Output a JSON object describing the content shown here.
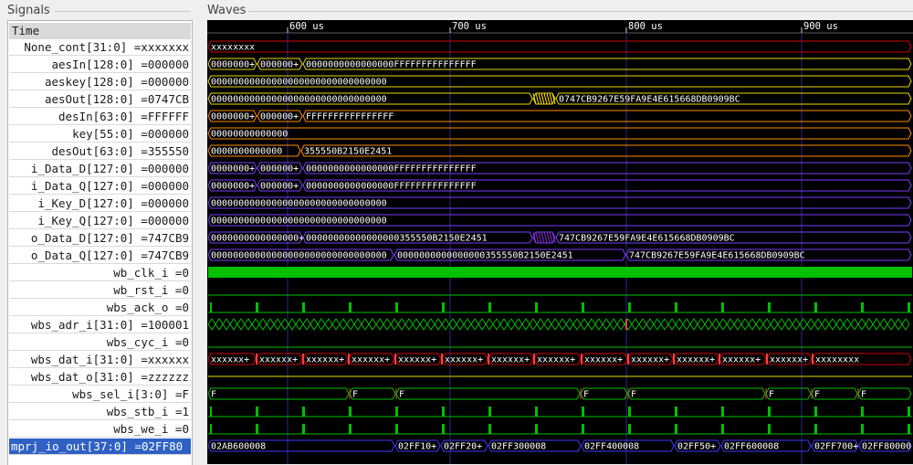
{
  "panels": {
    "signals_title": "Signals",
    "waves_title": "Waves"
  },
  "time_header": {
    "label": "Time",
    "markers": [
      "600 us",
      "700 us",
      "800 us",
      "900 us"
    ]
  },
  "colors": {
    "background": "#000000",
    "bus": "#3b3bff",
    "bit_high": "#00c000",
    "text": "#ffffff",
    "highlight_red": "#e00000",
    "highlight_yellow": "#ffe000",
    "highlight_purple": "#8a2be2",
    "selected_row": "#2f61c5"
  },
  "signals": [
    {
      "label": "None_cont[31:0] =xxxxxxx",
      "kind": "bus",
      "color": "#d00000",
      "segments": [
        [
          "xxxxxxxx"
        ]
      ]
    },
    {
      "label": "aesIn[128:0] =000000",
      "kind": "bus",
      "color": "#e8d800",
      "segments": [
        [
          "0000000+"
        ],
        [
          "000000+"
        ],
        [
          "0000000000000000FFFFFFFFFFFFFFF"
        ]
      ]
    },
    {
      "label": "aeskey[128:0] =000000",
      "kind": "bus",
      "color": "#e8d800",
      "segments": [
        [
          "00000000000000000000000000000000"
        ]
      ]
    },
    {
      "label": "aesOut[128:0] =0747CB",
      "kind": "bus",
      "color": "#e8d800",
      "segments": [
        [
          "00000000000000000000000000000000"
        ],
        [
          ""
        ],
        [
          "0747CB9267E59FA9E4E615668DB0909BC"
        ]
      ]
    },
    {
      "label": "desIn[63:0] =FFFFFF",
      "kind": "bus",
      "color": "#ff8c00",
      "segments": [
        [
          "0000000+"
        ],
        [
          "000000+"
        ],
        [
          "FFFFFFFFFFFFFFFF"
        ]
      ]
    },
    {
      "label": "key[55:0] =000000",
      "kind": "bus",
      "color": "#ff8c00",
      "segments": [
        [
          "00000000000000"
        ]
      ]
    },
    {
      "label": "desOut[63:0] =355550",
      "kind": "bus",
      "color": "#ff8c00",
      "segments": [
        [
          "0000000000000"
        ],
        [
          "355550B2150E2451"
        ]
      ]
    },
    {
      "label": "i_Data_D[127:0] =000000",
      "kind": "bus",
      "color": "#7a3cff",
      "segments": [
        [
          "0000000+"
        ],
        [
          "000000+"
        ],
        [
          "0000000000000000FFFFFFFFFFFFFFF"
        ]
      ]
    },
    {
      "label": "i_Data_Q[127:0] =000000",
      "kind": "bus",
      "color": "#7a3cff",
      "segments": [
        [
          "0000000+"
        ],
        [
          "000000+"
        ],
        [
          "0000000000000000FFFFFFFFFFFFFFF"
        ]
      ]
    },
    {
      "label": "i_Key_D[127:0] =000000",
      "kind": "bus",
      "color": "#7a3cff",
      "segments": [
        [
          "00000000000000000000000000000000"
        ]
      ]
    },
    {
      "label": "i_Key_Q[127:0] =000000",
      "kind": "bus",
      "color": "#7a3cff",
      "segments": [
        [
          "00000000000000000000000000000000"
        ]
      ]
    },
    {
      "label": "o_Data_D[127:0] =747CB9",
      "kind": "bus",
      "color": "#7a3cff",
      "segments": [
        [
          "0000000000000000+"
        ],
        [
          "00000000000000000355550B2150E2451"
        ],
        [
          ""
        ],
        [
          "747CB9267E59FA9E4E615668DB0909BC"
        ]
      ]
    },
    {
      "label": "o_Data_Q[127:0] =747CB9",
      "kind": "bus",
      "color": "#7a3cff",
      "segments": [
        [
          "00000000000000000000000000000000"
        ],
        [
          "0000000000000000355550B2150E2451"
        ],
        [
          "747CB9267E59FA9E4E615668DB0909BC"
        ]
      ]
    },
    {
      "label": "wb_clk_i =0",
      "kind": "clock",
      "color": "#00c000",
      "segments": []
    },
    {
      "label": "wb_rst_i =0",
      "kind": "bit-low",
      "color": "#00c000",
      "segments": []
    },
    {
      "label": "wbs_ack_o =0",
      "kind": "pulses",
      "color": "#00c000",
      "segments": []
    },
    {
      "label": "wbs_adr_i[31:0] =100001",
      "kind": "dense",
      "color": "#00c000",
      "segments": []
    },
    {
      "label": "wbs_cyc_i =0",
      "kind": "bit-low",
      "color": "#00c000",
      "segments": []
    },
    {
      "label": "wbs_dat_i[31:0] =xxxxxx",
      "kind": "repeat",
      "color": "#d00000",
      "segments": [
        [
          "xxxxxx+"
        ],
        [
          "xxxxxx+"
        ],
        [
          "xxxxxx+"
        ],
        [
          "xxxxxx+"
        ],
        [
          "xxxxxx+"
        ],
        [
          "xxxxxx+"
        ],
        [
          "xxxxxx+"
        ],
        [
          "xxxxxx+"
        ],
        [
          "xxxxxx+"
        ],
        [
          "xxxxxx+"
        ],
        [
          "xxxxxx+"
        ],
        [
          "xxxxxx+"
        ],
        [
          "xxxxxx+"
        ],
        [
          "xxxxxxxx"
        ]
      ]
    },
    {
      "label": "wbs_dat_o[31:0] =zzzzzz",
      "kind": "z",
      "color": "#e8d800",
      "segments": []
    },
    {
      "label": "wbs_sel_i[3:0] =F",
      "kind": "bus",
      "color": "#00c000",
      "segments": [
        [
          "F"
        ],
        [
          "F"
        ],
        [
          "F"
        ],
        [
          "F"
        ],
        [
          "F"
        ],
        [
          "F"
        ],
        [
          "F"
        ],
        [
          "F"
        ]
      ]
    },
    {
      "label": "wbs_stb_i =1",
      "kind": "pulses",
      "color": "#00c000",
      "segments": []
    },
    {
      "label": "wbs_we_i =0",
      "kind": "pulses",
      "color": "#00c000",
      "segments": []
    },
    {
      "label": "mprj_io_out[37:0] =02FF80",
      "kind": "bus",
      "color": "#3b3bff",
      "segments": [
        [
          "02AB600008"
        ],
        [
          "02FF10+"
        ],
        [
          "02FF20+"
        ],
        [
          "02FF300008"
        ],
        [
          "02FF400008"
        ],
        [
          "02FF50+"
        ],
        [
          "02FF600008"
        ],
        [
          "02FF700+"
        ],
        [
          "02FF80000"
        ]
      ]
    }
  ]
}
